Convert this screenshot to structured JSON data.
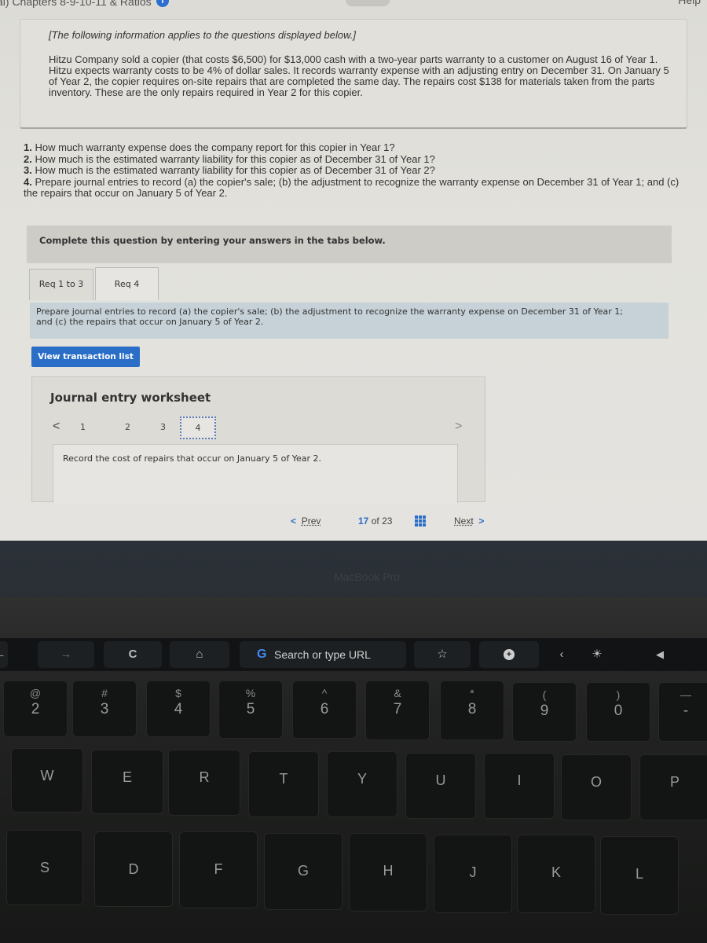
{
  "topbar": {
    "breadcrumb": "al) Chapters 8-9-10-11 & Ratios",
    "info_icon": "i",
    "help": "Help"
  },
  "info_box": {
    "intro": "[The following information applies to the questions displayed below.]",
    "body": "Hitzu Company sold a copier (that costs $6,500) for $13,000 cash with a two-year parts warranty to a customer on August 16 of Year 1. Hitzu expects warranty costs to be 4% of dollar sales. It records warranty expense with an adjusting entry on December 31. On January 5 of Year 2, the copier requires on-site repairs that are completed the same day. The repairs cost $138 for materials taken from the parts inventory. These are the only repairs required in Year 2 for this copier."
  },
  "questions": [
    {
      "num": "1.",
      "text": " How much warranty expense does the company report for this copier in Year 1?"
    },
    {
      "num": "2.",
      "text": " How much is the estimated warranty liability for this copier as of December 31 of Year 1?"
    },
    {
      "num": "3.",
      "text": " How much is the estimated warranty liability for this copier as of December 31 of Year 2?"
    },
    {
      "num": "4.",
      "text": " Prepare journal entries to record (a) the copier's sale; (b) the adjustment to recognize the warranty expense on December 31 of Year 1; and (c) the repairs that occur on January 5 of Year 2."
    }
  ],
  "instruction": "Complete this question by entering your answers in the tabs below.",
  "tabs": [
    {
      "label": "Req 1 to 3",
      "active": false
    },
    {
      "label": "Req 4",
      "active": true
    }
  ],
  "req_description": {
    "line1": "Prepare journal entries to record (a) the copier's sale; (b) the adjustment to recognize the warranty expense on December 31 of Year 1;",
    "line2": "and (c) the repairs that occur on January 5 of Year 2."
  },
  "view_transaction_button": "View transaction list",
  "worksheet": {
    "title": "Journal entry worksheet",
    "prev": "<",
    "next": ">",
    "pages": [
      "1",
      "2",
      "3",
      "4"
    ],
    "active_page": "4",
    "content": "Record the cost of repairs that occur on January 5 of Year 2."
  },
  "pager": {
    "prev_chev": "<",
    "prev": "Prev",
    "current": "17",
    "of": "of",
    "total": "23",
    "next": "Next",
    "next_chev": ">"
  },
  "bezel": {
    "brand": "MacBook Pro"
  },
  "touchbar": {
    "back": "←",
    "forward": "→",
    "reload": "C",
    "home": "⌂",
    "search_g": "G",
    "search_placeholder": "Search or type URL",
    "star": "☆",
    "new_tab": "+",
    "collapse": "‹",
    "brightness": "☀",
    "volume": "◀"
  },
  "keyboard": {
    "number_row": [
      {
        "top": "@",
        "bot": "2"
      },
      {
        "top": "#",
        "bot": "3"
      },
      {
        "top": "$",
        "bot": "4"
      },
      {
        "top": "%",
        "bot": "5"
      },
      {
        "top": "^",
        "bot": "6"
      },
      {
        "top": "&",
        "bot": "7"
      },
      {
        "top": "*",
        "bot": "8"
      },
      {
        "top": "(",
        "bot": "9"
      },
      {
        "top": ")",
        "bot": "0"
      },
      {
        "top": "—",
        "bot": "-"
      }
    ],
    "top_row": [
      "W",
      "E",
      "R",
      "T",
      "Y",
      "U",
      "I",
      "O",
      "P"
    ],
    "home_row": [
      "S",
      "D",
      "F",
      "G",
      "H",
      "J",
      "K",
      "L"
    ]
  }
}
